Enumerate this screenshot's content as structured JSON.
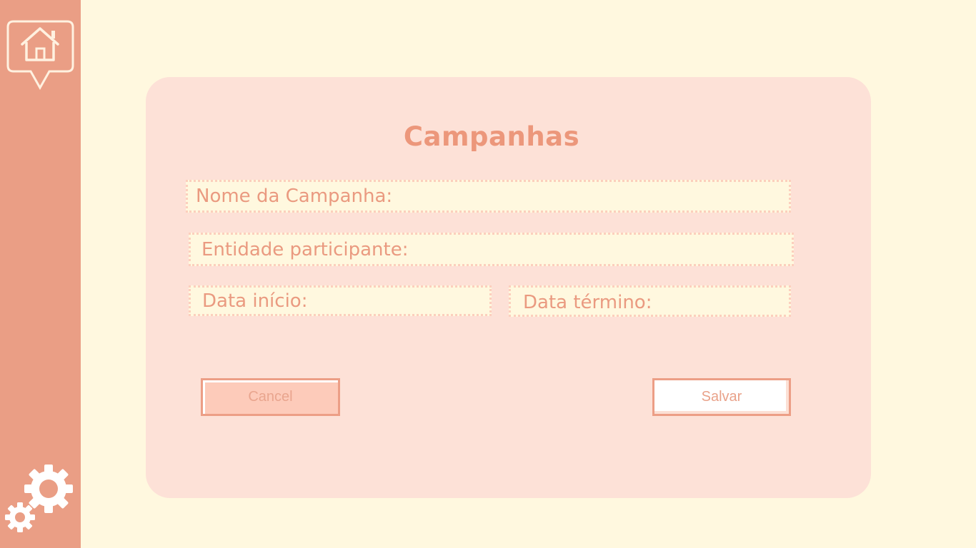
{
  "sidebar": {
    "home_icon": "home-icon",
    "settings_icon": "gears-icon"
  },
  "form": {
    "title": "Campanhas",
    "fields": {
      "nome_label": "Nome da Campanha:",
      "entidade_label": "Entidade participante:",
      "data_inicio_label": "Data início:",
      "data_termino_label": "Data término:"
    },
    "buttons": {
      "cancel_label": "Cancel",
      "save_label": "Salvar"
    }
  },
  "colors": {
    "background": "#FFF8DF",
    "sidebar": "#EA9E85",
    "card": "#FDE1D7",
    "accent_text": "#EC977B"
  }
}
